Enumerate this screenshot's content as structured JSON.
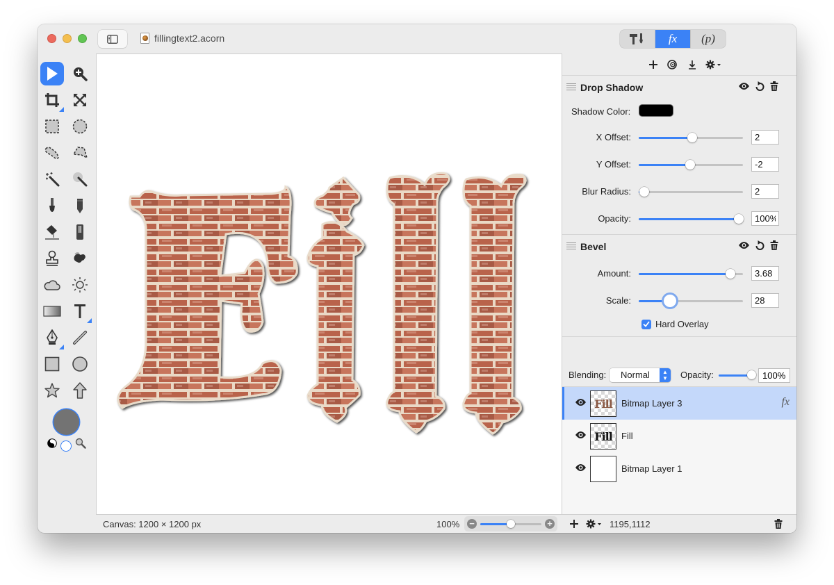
{
  "window": {
    "document_title": "fillingtext2.acorn",
    "traffic_lights": [
      "close",
      "minimize",
      "zoom"
    ]
  },
  "inspector_tabs": [
    {
      "name": "tools-inspector",
      "label": "T!",
      "icon": "hammer-brush-icon",
      "active": false
    },
    {
      "name": "filters-inspector",
      "label": "fx",
      "icon": "fx-icon",
      "active": true
    },
    {
      "name": "properties-inspector",
      "label": "(p)",
      "icon": "p-icon",
      "active": false
    }
  ],
  "fx_toolbar": [
    {
      "icon": "plus-icon",
      "glyph": "+"
    },
    {
      "icon": "filter-preview-icon",
      "glyph": "◎"
    },
    {
      "icon": "download-icon",
      "glyph": "⤓"
    },
    {
      "icon": "gear-menu-icon",
      "glyph": "⚙▾"
    }
  ],
  "tools": [
    "move-arrow-icon",
    "zoom-icon",
    "crop-icon",
    "transform-icon",
    "rect-select-icon",
    "ellipse-select-icon",
    "lasso-icon",
    "polygon-lasso-icon",
    "magic-wand-icon",
    "instant-alpha-icon",
    "brush-icon",
    "pencil-icon",
    "paint-bucket-icon",
    "eraser-icon",
    "clone-stamp-icon",
    "smudge-icon",
    "cloud-icon",
    "sun-icon",
    "gradient-icon",
    "text-tool-icon",
    "pen-icon",
    "line-icon",
    "rectangle-shape-icon",
    "circle-shape-icon",
    "star-shape-icon",
    "arrow-shape-icon"
  ],
  "colors": {
    "accent": "#3b82f6",
    "foreground_color": "#737373",
    "background_color": "#ffffff",
    "shadow_color": "#000000",
    "selected_layer_bg": "#c4d8fa"
  },
  "canvas": {
    "artwork_text": "Fill",
    "size_label": "Canvas: 1200 × 1200 px",
    "zoom_label": "100%",
    "zoom_fraction": 0.5
  },
  "drop_shadow": {
    "title": "Drop Shadow",
    "shadow_color_label": "Shadow Color:",
    "x_offset": {
      "label": "X Offset:",
      "value": "2",
      "fraction": 0.51
    },
    "y_offset": {
      "label": "Y Offset:",
      "value": "-2",
      "fraction": 0.49
    },
    "blur_radius": {
      "label": "Blur Radius:",
      "value": "2",
      "fraction": 0.05
    },
    "opacity": {
      "label": "Opacity:",
      "value": "100%",
      "fraction": 0.96
    }
  },
  "bevel": {
    "title": "Bevel",
    "amount": {
      "label": "Amount:",
      "value": "3.68",
      "fraction": 0.88
    },
    "scale": {
      "label": "Scale:",
      "value": "28",
      "fraction": 0.3
    },
    "hard_overlay": {
      "label": "Hard Overlay",
      "checked": true
    }
  },
  "blending": {
    "label": "Blending:",
    "mode": "Normal",
    "opacity_label": "Opacity:",
    "opacity_value": "100%",
    "opacity_fraction": 1.0
  },
  "layers": [
    {
      "name": "Bitmap Layer 3",
      "selected": true,
      "visible": true,
      "has_fx": true,
      "fx_label": "fx",
      "thumb": "Fill"
    },
    {
      "name": "Fill",
      "selected": false,
      "visible": true,
      "has_fx": false,
      "thumb": "Fill"
    },
    {
      "name": "Bitmap Layer 1",
      "selected": false,
      "visible": true,
      "has_fx": false,
      "thumb": ""
    }
  ],
  "status": {
    "coordinates": "1195,1112"
  }
}
